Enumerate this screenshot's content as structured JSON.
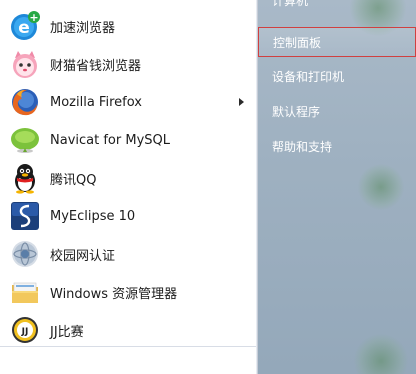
{
  "programs": [
    {
      "label": "加速浏览器",
      "icon": "accelerated-browser-icon"
    },
    {
      "label": "财猫省钱浏览器",
      "icon": "caimao-browser-icon"
    },
    {
      "label": "Mozilla Firefox",
      "icon": "firefox-icon",
      "has_submenu": true
    },
    {
      "label": "Navicat for MySQL",
      "icon": "navicat-icon"
    },
    {
      "label": "腾讯QQ",
      "icon": "qq-penguin-icon"
    },
    {
      "label": "MyEclipse 10",
      "icon": "myeclipse-icon"
    },
    {
      "label": "校园网认证",
      "icon": "campus-network-icon"
    },
    {
      "label": "Windows 资源管理器",
      "icon": "windows-explorer-icon"
    },
    {
      "label": "JJ比赛",
      "icon": "jj-game-icon"
    }
  ],
  "right_links": {
    "computer": "计算机",
    "control_panel": "控制面板",
    "devices_printers": "设备和打印机",
    "default_programs": "默认程序",
    "help_support": "帮助和支持"
  },
  "colors": {
    "right_pane": "#9fb1c1",
    "highlight_border": "#d04040",
    "program_text": "#1b1b1b"
  }
}
